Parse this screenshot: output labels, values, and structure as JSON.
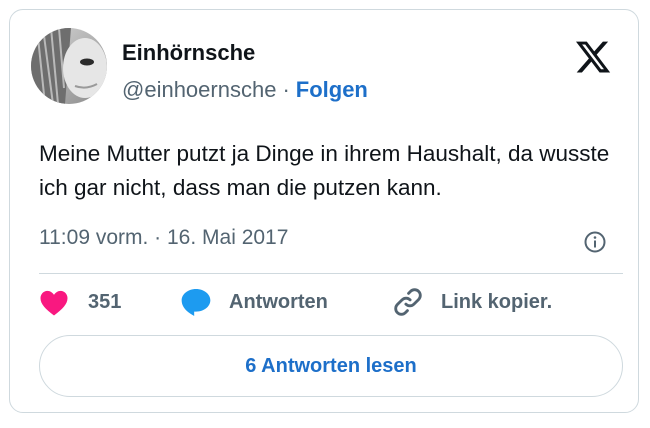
{
  "author": {
    "display_name": "Einhörnsche",
    "handle": "@einhoernsche",
    "separator": "·",
    "follow_label": "Folgen"
  },
  "tweet": {
    "text": "Meine Mutter putzt ja Dinge in ihrem Haushalt, da wusste ich gar nicht, dass man die putzen kann.",
    "timestamp": "11:09 vorm. · 16. Mai 2017"
  },
  "actions": {
    "like_count": "351",
    "reply_label": "Antworten",
    "copy_link_label": "Link kopier."
  },
  "read_replies_label": "6 Antworten lesen",
  "icons": {
    "logo": "x-logo-icon",
    "info": "info-icon",
    "like": "heart-icon",
    "reply": "speech-bubble-icon",
    "copy": "link-icon"
  },
  "colors": {
    "like": "#f91880",
    "reply": "#1d9bf0",
    "link": "#1d6fc9",
    "muted": "#536471",
    "border": "#cfd9de"
  }
}
